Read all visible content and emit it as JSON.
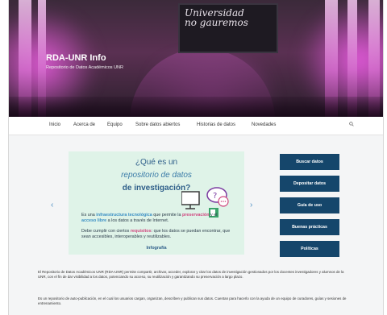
{
  "site": {
    "title": "RDA-UNR Info",
    "subtitle": "Repositorio de Datos Académicos UNR",
    "banner_text": "Universidad\nno gauremos"
  },
  "nav": {
    "items": [
      "Inicio",
      "Acerca de",
      "Equipo",
      "Sobre datos abiertos",
      "Historias de datos",
      "Novedades"
    ],
    "search_icon": "search-icon"
  },
  "slide": {
    "heading_line1": "¿Qué es un",
    "heading_line2": "repositorio de datos",
    "heading_line3": "de investigación?",
    "p1_a": "Es una ",
    "p1_hl1": "infraestructura tecnológica",
    "p1_b": " que permite la ",
    "p1_hl2": "preservación",
    "p1_c": " y el ",
    "p1_hl3": "acceso libre",
    "p1_d": " a los datos a través de Internet.",
    "p2_a": "Debe cumplir con ciertos ",
    "p2_hl": "requisitos",
    "p2_b": ": que los datos se puedan encontrar, que sean accesibles, interoperables y reutilizables.",
    "caption": "Infografía",
    "prev_arrow": "‹",
    "next_arrow": "›"
  },
  "sidebar_buttons": [
    "Buscar datos",
    "Depositar datos",
    "Guía de uso",
    "Buenas prácticas",
    "Políticas"
  ],
  "body": {
    "paragraph1": "El Repositorio de Datos Académicos UNR (RDA-UNR) permite compartir, archivar, acceder, explorar y citar los datos de investigación gestionados por los docentes investigadores y alumnos de la UNR, con el fin de dar visibilidad a los datos, potenciando su acceso, su reutilización y garantizando su preservación a largo plazo.",
    "paragraph2": "Es un repositorio de auto-publicación, en el cual los usuarios cargan, organizan, describen y publican sus datos. Cuentan para hacerlo con la ayuda de un equipo de curadores, guías y sesiones de entrenamiento."
  },
  "colors": {
    "button_bg": "#15466b",
    "slide_bg": "#dff3e8",
    "accent_blue": "#3b8fc4",
    "accent_pink": "#d0467f"
  }
}
